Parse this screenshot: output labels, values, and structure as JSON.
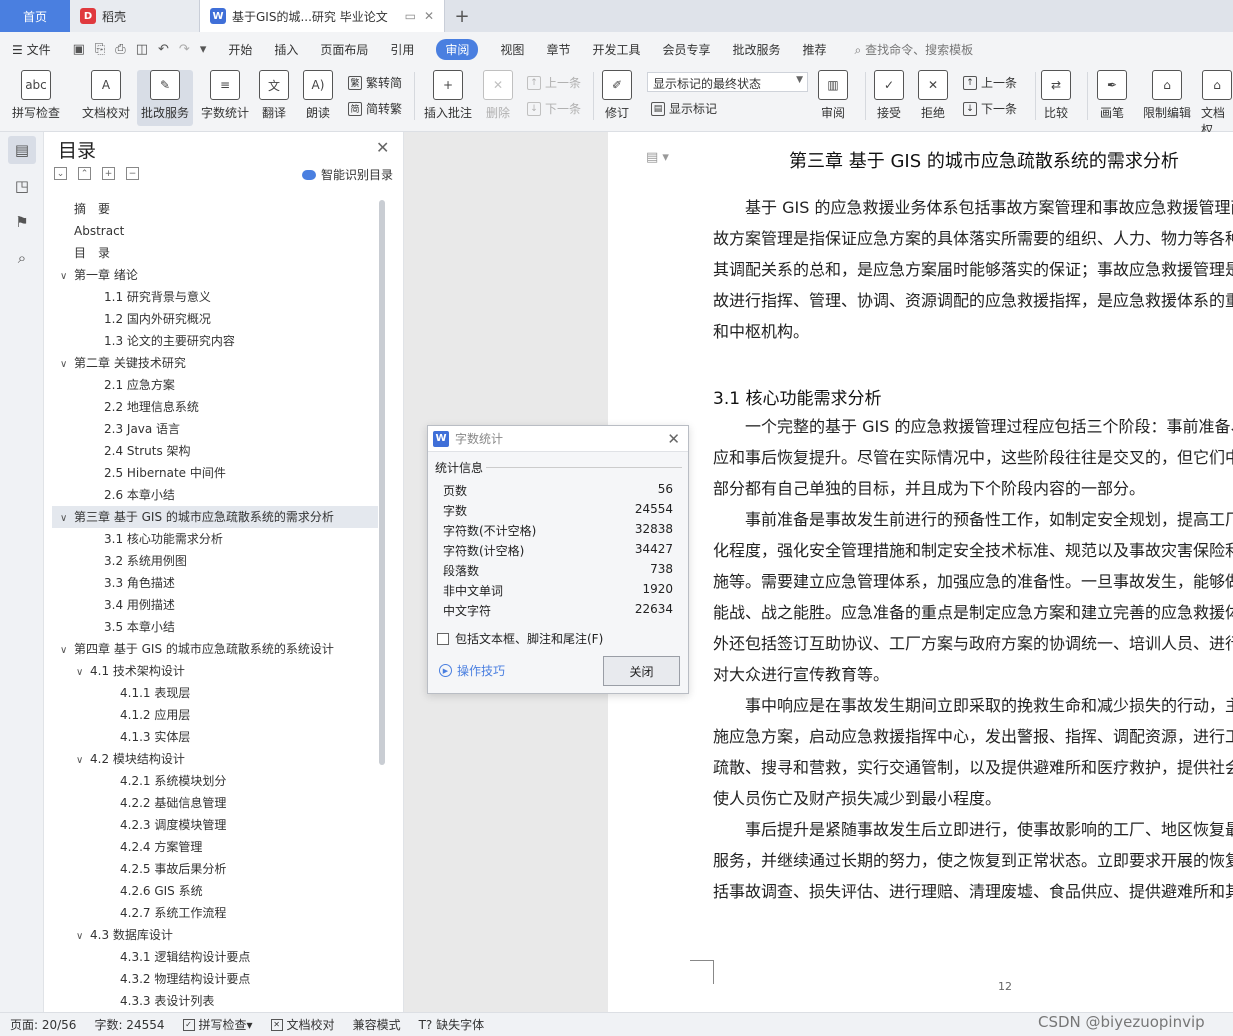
{
  "tabs": {
    "home": "首页",
    "docer": "稻壳",
    "doc": "基于GIS的城...研究 毕业论文"
  },
  "menu": {
    "file": "文件",
    "items": [
      "开始",
      "插入",
      "页面布局",
      "引用",
      "审阅",
      "视图",
      "章节",
      "开发工具",
      "会员专享",
      "批改服务",
      "推荐"
    ],
    "active_index": 4,
    "search": "查找命令、搜索模板"
  },
  "ribbon": {
    "spellcheck": "拼写检查",
    "proofread": "文档校对",
    "review_service": "批改服务",
    "word_count": "字数统计",
    "translate": "翻译",
    "read_aloud": "朗读",
    "trad_simp": "繁转简",
    "simp_trad": "简转繁",
    "insert_comment": "插入批注",
    "delete": "删除",
    "prev": "上一条",
    "next": "下一条",
    "track": "修订",
    "markup_state": "显示标记的最终状态",
    "show_markup": "显示标记",
    "review_pane": "审阅",
    "accept": "接受",
    "reject": "拒绝",
    "prev2": "上一条",
    "next2": "下一条",
    "compare": "比较",
    "pen": "画笔",
    "restrict": "限制编辑",
    "doc_more": "文档权"
  },
  "toc": {
    "title": "目录",
    "smart": "智能识别目录",
    "items": [
      {
        "label": "摘　要",
        "level": 0,
        "chev": ""
      },
      {
        "label": "Abstract",
        "level": 0,
        "chev": ""
      },
      {
        "label": "目　录",
        "level": 0,
        "chev": ""
      },
      {
        "label": "第一章  绪论",
        "level": 0,
        "chev": "v"
      },
      {
        "label": "1.1  研究背景与意义",
        "level": 1,
        "chev": ""
      },
      {
        "label": "1.2  国内外研究概况",
        "level": 1,
        "chev": ""
      },
      {
        "label": "1.3  论文的主要研究内容",
        "level": 1,
        "chev": ""
      },
      {
        "label": "第二章  关键技术研究",
        "level": 0,
        "chev": "v"
      },
      {
        "label": "2.1  应急方案",
        "level": 1,
        "chev": ""
      },
      {
        "label": "2.2  地理信息系统",
        "level": 1,
        "chev": ""
      },
      {
        "label": "2.3 Java 语言",
        "level": 1,
        "chev": ""
      },
      {
        "label": "2.4 Struts 架构",
        "level": 1,
        "chev": ""
      },
      {
        "label": "2.5 Hibernate 中间件",
        "level": 1,
        "chev": ""
      },
      {
        "label": "2.6  本章小结",
        "level": 1,
        "chev": ""
      },
      {
        "label": "第三章  基于 GIS 的城市应急疏散系统的需求分析",
        "level": 0,
        "chev": "v",
        "selected": true
      },
      {
        "label": "3.1  核心功能需求分析",
        "level": 1,
        "chev": ""
      },
      {
        "label": "3.2  系统用例图",
        "level": 1,
        "chev": ""
      },
      {
        "label": "3.3  角色描述",
        "level": 1,
        "chev": ""
      },
      {
        "label": "3.4  用例描述",
        "level": 1,
        "chev": ""
      },
      {
        "label": "3.5  本章小结",
        "level": 1,
        "chev": ""
      },
      {
        "label": "第四章  基于 GIS 的城市应急疏散系统的系统设计",
        "level": 0,
        "chev": "v"
      },
      {
        "label": "4.1    技术架构设计",
        "level": 1,
        "chev": "v"
      },
      {
        "label": "4.1.1  表现层",
        "level": 2,
        "chev": ""
      },
      {
        "label": "4.1.2  应用层",
        "level": 2,
        "chev": ""
      },
      {
        "label": "4.1.3  实体层",
        "level": 2,
        "chev": ""
      },
      {
        "label": "4.2  模块结构设计",
        "level": 1,
        "chev": "v"
      },
      {
        "label": "4.2.1  系统模块划分",
        "level": 2,
        "chev": ""
      },
      {
        "label": "4.2.2  基础信息管理",
        "level": 2,
        "chev": ""
      },
      {
        "label": "4.2.3  调度模块管理",
        "level": 2,
        "chev": ""
      },
      {
        "label": "4.2.4  方案管理",
        "level": 2,
        "chev": ""
      },
      {
        "label": "4.2.5  事故后果分析",
        "level": 2,
        "chev": ""
      },
      {
        "label": "4.2.6 GIS 系统",
        "level": 2,
        "chev": ""
      },
      {
        "label": "4.2.7  系统工作流程",
        "level": 2,
        "chev": ""
      },
      {
        "label": "4.3  数据库设计",
        "level": 1,
        "chev": "v"
      },
      {
        "label": "4.3.1  逻辑结构设计要点",
        "level": 2,
        "chev": ""
      },
      {
        "label": "4.3.2  物理结构设计要点",
        "level": 2,
        "chev": ""
      },
      {
        "label": "4.3.3  表设计列表",
        "level": 2,
        "chev": ""
      }
    ]
  },
  "document": {
    "chapter_title": "第三章  基于 GIS 的城市应急疏散系统的需求分析",
    "para1": [
      "　　基于 GIS 的应急救援业务体系包括事故方案管理和事故应急救援管理两",
      "故方案管理是指保证应急方案的具体落实所需要的组织、人力、物力等各种",
      "其调配关系的总和，是应急方案届时能够落实的保证；事故应急救援管理是",
      "故进行指挥、管理、协调、资源调配的应急救援指挥，是应急救援体系的重",
      "和中枢机构。"
    ],
    "section_title": "3.1  核心功能需求分析",
    "para2": [
      "　　一个完整的基于 GIS 的应急救援管理过程应包括三个阶段：事前准备、",
      "应和事后恢复提升。尽管在实际情况中，这些阶段往往是交叉的，但它们中",
      "部分都有自己单独的目标，并且成为下个阶段内容的一部分。",
      "　　事前准备是事故发生前进行的预备性工作，如制定安全规划，提高工厂",
      "化程度，强化安全管理措施和制定安全技术标准、规范以及事故灾害保险利",
      "施等。需要建立应急管理体系，加强应急的准备性。一旦事故发生，能够做",
      "能战、战之能胜。应急准备的重点是制定应急方案和建立完善的应急救援体",
      "外还包括签订互助协议、工厂方案与政府方案的协调统一、培训人员、进行",
      "对大众进行宣传教育等。",
      "　　事中响应是在事故发生期间立即采取的挽救生命和减少损失的行动，主",
      "施应急方案，启动应急救援指挥中心，发出警报、指挥、调配资源，进行工",
      "疏散、搜寻和营救，实行交通管制，以及提供避难所和医疗救护，提供社会",
      "使人员伤亡及财产损失减少到最小程度。",
      "　　事后提升是紧随事故发生后立即进行，使事故影响的工厂、地区恢复最",
      "服务，并继续通过长期的努力，使之恢复到正常状态。立即要求开展的恢复",
      "括事故调查、损失评估、进行理赔、清理废墟、食品供应、提供避难所和其"
    ],
    "page_number": "12"
  },
  "dialog": {
    "title": "字数统计",
    "section": "统计信息",
    "rows": [
      {
        "label": "页数",
        "value": "56"
      },
      {
        "label": "字数",
        "value": "24554"
      },
      {
        "label": "字符数(不计空格)",
        "value": "32838"
      },
      {
        "label": "字符数(计空格)",
        "value": "34427"
      },
      {
        "label": "段落数",
        "value": "738"
      },
      {
        "label": "非中文单词",
        "value": "1920"
      },
      {
        "label": "中文字符",
        "value": "22634"
      }
    ],
    "include_label": "包括文本框、脚注和尾注(F)",
    "tips": "操作技巧",
    "close": "关闭"
  },
  "status": {
    "page": "页面: 20/56",
    "words": "字数: 24554",
    "spell": "拼写检查",
    "proof": "文档校对",
    "compat": "兼容模式",
    "missing_font": "缺失字体",
    "watermark": "CSDN @biyezuopinvip"
  },
  "colors": {
    "accent": "#4a7fe0"
  }
}
